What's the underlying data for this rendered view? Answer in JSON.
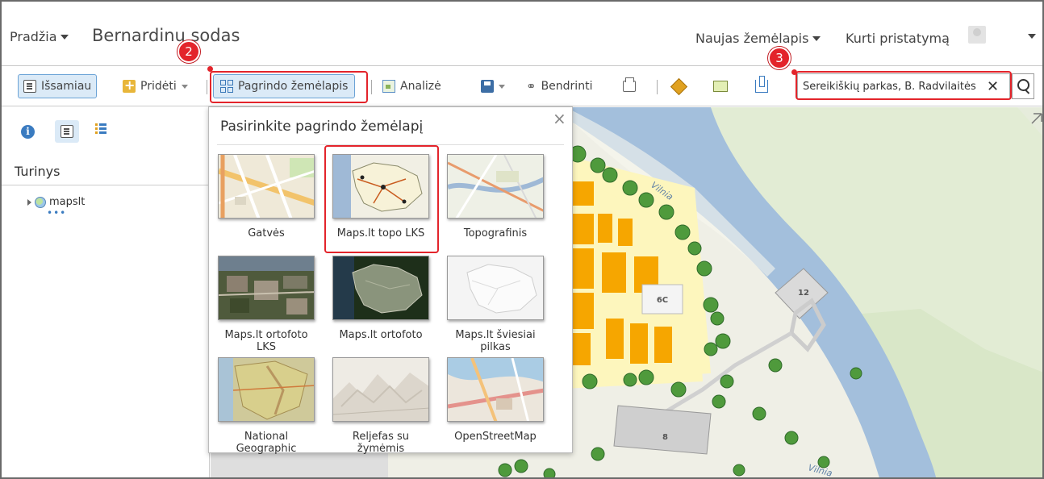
{
  "header": {
    "home_label": "Pradžia",
    "map_title": "Bernardinų sodas",
    "new_map_label": "Naujas žemėlapis",
    "create_presentation_label": "Kurti pristatymą"
  },
  "toolbar": {
    "details_label": "Išsamiau",
    "add_label": "Pridėti",
    "basemap_label": "Pagrindo žemėlapis",
    "analysis_label": "Analizė",
    "share_label": "Bendrinti",
    "search": {
      "value": "Sereikiškių parkas, B. Radvilaitės"
    }
  },
  "callouts": [
    {
      "number": "2"
    },
    {
      "number": "3"
    }
  ],
  "left_panel": {
    "contents_title": "Turinys",
    "layer_name": "mapslt",
    "layer_more": "•••"
  },
  "gallery": {
    "title": "Pasirinkite pagrindo žemėlapį",
    "close_symbol": "×",
    "items": [
      {
        "label": "Gatvės"
      },
      {
        "label": "Maps.lt topo LKS"
      },
      {
        "label": "Topografinis"
      },
      {
        "label": "Maps.lt ortofoto LKS"
      },
      {
        "label": "Maps.lt ortofoto"
      },
      {
        "label": "Maps.lt šviesiai pilkas"
      },
      {
        "label": "National Geographic"
      },
      {
        "label": "Reljefas su žymėmis"
      },
      {
        "label": "OpenStreetMap"
      }
    ]
  },
  "map": {
    "labels": {
      "river_upper": "Vilnia",
      "river_lower": "Vilnia",
      "building_6c": "6C",
      "building_12": "12",
      "building_8": "8"
    }
  },
  "colors": {
    "accent_blue": "#3a7bc0",
    "highlight_red": "#e3242b",
    "river": "#a3bfdc",
    "building_orange": "#f6a600",
    "building_yellow": "#fdf6bd"
  }
}
